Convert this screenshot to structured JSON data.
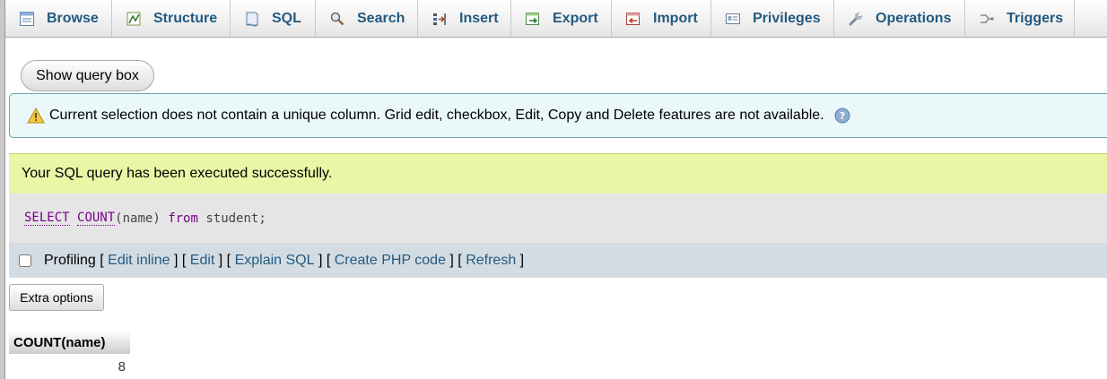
{
  "tabs": [
    {
      "label": "Browse",
      "icon": "browse-icon"
    },
    {
      "label": "Structure",
      "icon": "structure-icon"
    },
    {
      "label": "SQL",
      "icon": "sql-icon"
    },
    {
      "label": "Search",
      "icon": "search-icon"
    },
    {
      "label": "Insert",
      "icon": "insert-icon"
    },
    {
      "label": "Export",
      "icon": "export-icon"
    },
    {
      "label": "Import",
      "icon": "import-icon"
    },
    {
      "label": "Privileges",
      "icon": "privileges-icon"
    },
    {
      "label": "Operations",
      "icon": "operations-icon"
    },
    {
      "label": "Triggers",
      "icon": "triggers-icon"
    }
  ],
  "show_query_box": "Show query box",
  "notice": {
    "text": "Current selection does not contain a unique column. Grid edit, checkbox, Edit, Copy and Delete features are not available.",
    "icon": "warning-icon",
    "help_icon": "help-icon"
  },
  "success": "Your SQL query has been executed successfully.",
  "sql": {
    "select": "SELECT",
    "count": "COUNT",
    "arg": "(name)",
    "from": "from",
    "table": "student;"
  },
  "toolbar": {
    "profiling": "Profiling",
    "links": [
      "Edit inline",
      "Edit",
      "Explain SQL",
      "Create PHP code",
      "Refresh"
    ]
  },
  "extra_options": "Extra options",
  "result": {
    "columns": [
      "COUNT(name)"
    ],
    "rows": [
      [
        "8"
      ]
    ]
  },
  "colors": {
    "link": "#235a81",
    "success_bg": "#ebf5a6",
    "notice_bg": "#ebf8fa",
    "toolbar_bg": "#d3dce3",
    "keyword": "#770088"
  }
}
